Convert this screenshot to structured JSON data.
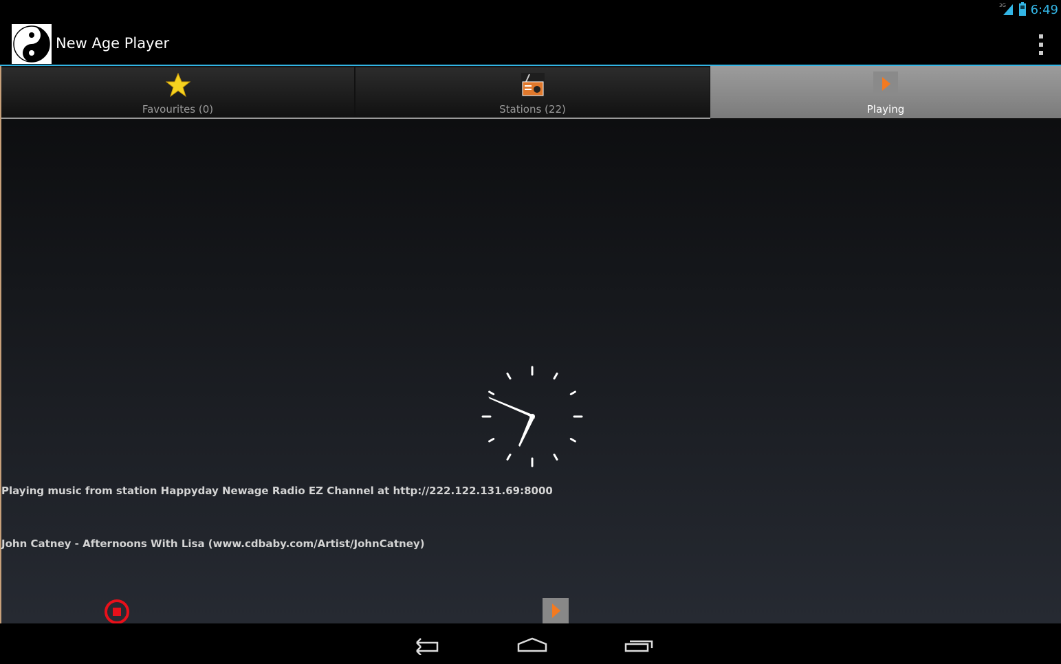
{
  "status_bar": {
    "time": "6:49",
    "network_label": "3G",
    "signal_icon": "signal-icon",
    "battery_icon": "battery-icon",
    "accent_color": "#33b5e5"
  },
  "action_bar": {
    "title": "New Age Player",
    "logo_icon": "yin-yang-icon",
    "overflow_icon": "overflow-menu-icon"
  },
  "tabs": [
    {
      "label": "Favourites (0)",
      "icon": "star-icon",
      "selected": false
    },
    {
      "label": "Stations (22)",
      "icon": "radio-icon",
      "selected": false
    },
    {
      "label": "Playing",
      "icon": "play-icon",
      "selected": true
    }
  ],
  "playing": {
    "status_text": "Playing music from station Happyday Newage Radio EZ Channel at http://222.122.131.69:8000",
    "track_text": "John Catney - Afternoons With Lisa (www.cdbaby.com/Artist/JohnCatney)",
    "clock_icon": "analog-clock-icon",
    "stop_icon": "stop-icon",
    "play_icon": "play-icon",
    "stop_color": "#e8101a",
    "play_color": "#f47a20"
  },
  "nav_bar": {
    "back_icon": "back-icon",
    "home_icon": "home-icon",
    "recents_icon": "recent-apps-icon"
  }
}
